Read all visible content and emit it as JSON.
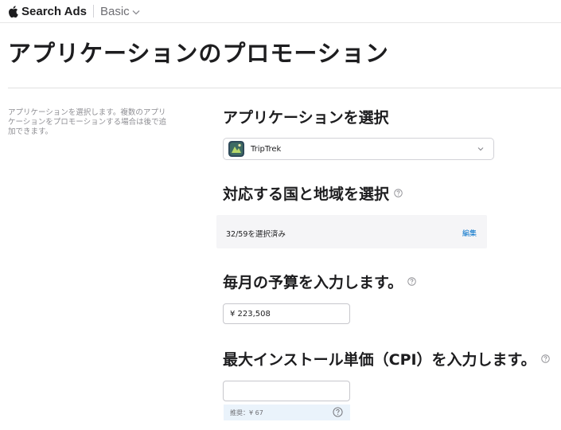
{
  "header": {
    "brand": "Search Ads",
    "plan": "Basic"
  },
  "page": {
    "title": "アプリケーションのプロモーション"
  },
  "sidebar": {
    "help_text": "アプリケーションを選択します。複数のアプリケーションをプロモーションする場合は後で追加できます。"
  },
  "app_section": {
    "heading": "アプリケーションを選択",
    "selected_app": "TripTrek"
  },
  "countries_section": {
    "heading": "対応する国と地域を選択",
    "summary": "32/59を選択済み",
    "edit_label": "編集"
  },
  "budget_section": {
    "heading": "毎月の予算を入力します。",
    "value": "¥ 223,508"
  },
  "cpi_section": {
    "heading": "最大インストール単価（CPI）を入力します。",
    "value": "",
    "hint": "推奨：¥ 67"
  },
  "colors": {
    "accent": "#0070c9",
    "hint_background": "#eaf3fb",
    "panel_background": "#f5f5f7"
  },
  "icons": {
    "brand": "apple-logo-icon",
    "plan": "chevron-down-icon",
    "help": "question-circle-icon"
  }
}
